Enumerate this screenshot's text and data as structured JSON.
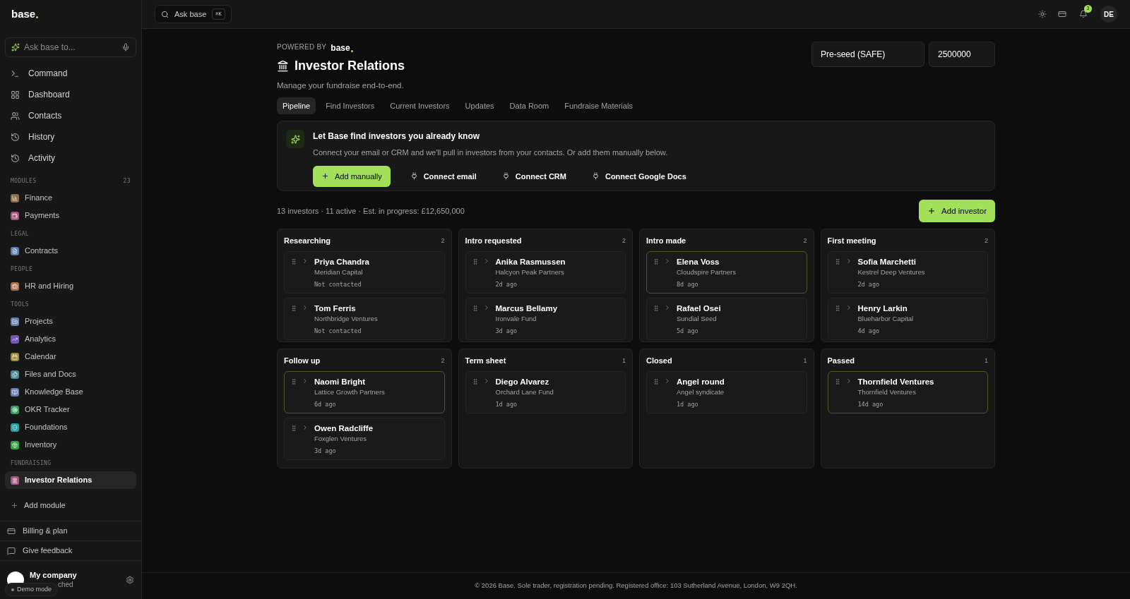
{
  "sidebar": {
    "logo": "base",
    "ask_placeholder": "Ask base to...",
    "nav": [
      {
        "label": "Command"
      },
      {
        "label": "Dashboard"
      },
      {
        "label": "Contacts"
      },
      {
        "label": "History"
      },
      {
        "label": "Activity"
      }
    ],
    "sections": [
      {
        "title": "MODULES",
        "count": "23",
        "items": [
          {
            "label": "Finance",
            "color": "#8a6e4c",
            "selected": false
          },
          {
            "label": "Payments",
            "color": "#a2567c",
            "selected": false
          }
        ]
      },
      {
        "title": "LEGAL",
        "items": [
          {
            "label": "Contracts",
            "color": "#5b7cab",
            "selected": false
          }
        ]
      },
      {
        "title": "PEOPLE",
        "items": [
          {
            "label": "HR and Hiring",
            "color": "#ad6d48",
            "selected": false
          }
        ]
      },
      {
        "title": "TOOLS",
        "items": [
          {
            "label": "Projects",
            "color": "#6a7db0",
            "selected": false
          },
          {
            "label": "Analytics",
            "color": "#7457b5",
            "selected": false
          },
          {
            "label": "Calendar",
            "color": "#9c8a3f",
            "selected": false
          },
          {
            "label": "Files and Docs",
            "color": "#4a8797",
            "selected": false
          },
          {
            "label": "Knowledge Base",
            "color": "#6880b2",
            "selected": false
          },
          {
            "label": "OKR Tracker",
            "color": "#3a9a62",
            "selected": false
          },
          {
            "label": "Foundations",
            "color": "#2a9fa3",
            "selected": false
          },
          {
            "label": "Inventory",
            "color": "#33a644",
            "selected": false
          }
        ]
      },
      {
        "title": "FUNDRAISING",
        "items": [
          {
            "label": "Investor Relations",
            "color": "#a0587c",
            "selected": true
          }
        ]
      }
    ],
    "add_module": "Add module",
    "footer_links": [
      {
        "label": "Billing & plan"
      },
      {
        "label": "Give feedback"
      }
    ],
    "company": {
      "name": "My company",
      "subtitle": "ched",
      "badge": "Demo mode"
    }
  },
  "topbar": {
    "search": "Ask base",
    "shortcut": "⌘K",
    "notifications": "3",
    "avatar": "DE"
  },
  "header": {
    "powered_by": "POWERED BY",
    "brand": "base",
    "title": "Investor Relations",
    "subtitle": "Manage your fundraise end-to-end.",
    "round": "Pre-seed (SAFE)",
    "amount": "2500000"
  },
  "tabs": [
    {
      "label": "Pipeline",
      "selected": true
    },
    {
      "label": "Find Investors",
      "selected": false
    },
    {
      "label": "Current Investors",
      "selected": false
    },
    {
      "label": "Updates",
      "selected": false
    },
    {
      "label": "Data Room",
      "selected": false
    },
    {
      "label": "Fundraise Materials",
      "selected": false
    }
  ],
  "banner": {
    "title": "Let Base find investors you already know",
    "text": "Connect your email or CRM and we'll pull in investors from your contacts. Or add them manually below.",
    "primary": "Add manually",
    "links": [
      "Connect email",
      "Connect CRM",
      "Connect Google Docs"
    ]
  },
  "summary": "13 investors · 11 active · Est. in progress: £12,650,000",
  "add_investor": "Add investor",
  "columns": [
    {
      "title": "Researching",
      "count": "2",
      "cards": [
        {
          "name": "Priya Chandra",
          "firm": "Meridian Capital",
          "status": "Not contacted",
          "highlighted": false
        },
        {
          "name": "Tom Ferris",
          "firm": "Northbridge Ventures",
          "status": "Not contacted",
          "highlighted": false
        }
      ]
    },
    {
      "title": "Intro requested",
      "count": "2",
      "cards": [
        {
          "name": "Anika Rasmussen",
          "firm": "Halcyon Peak Partners",
          "status": "2d ago",
          "highlighted": false
        },
        {
          "name": "Marcus Bellamy",
          "firm": "Ironvale Fund",
          "status": "3d ago",
          "highlighted": false
        }
      ]
    },
    {
      "title": "Intro made",
      "count": "2",
      "cards": [
        {
          "name": "Elena Voss",
          "firm": "Cloudspire Partners",
          "status": "8d ago",
          "highlighted": true
        },
        {
          "name": "Rafael Osei",
          "firm": "Sundial Seed",
          "status": "5d ago",
          "highlighted": false
        }
      ]
    },
    {
      "title": "First meeting",
      "count": "2",
      "cards": [
        {
          "name": "Sofia Marchetti",
          "firm": "Kestrel Deep Ventures",
          "status": "2d ago",
          "highlighted": false
        },
        {
          "name": "Henry Larkin",
          "firm": "Blueharbor Capital",
          "status": "4d ago",
          "highlighted": false
        }
      ]
    },
    {
      "title": "Follow up",
      "count": "2",
      "cards": [
        {
          "name": "Naomi Bright",
          "firm": "Lattice Growth Partners",
          "status": "6d ago",
          "highlighted": true
        },
        {
          "name": "Owen Radcliffe",
          "firm": "Foxglen Ventures",
          "status": "3d ago",
          "highlighted": false
        }
      ]
    },
    {
      "title": "Term sheet",
      "count": "1",
      "cards": [
        {
          "name": "Diego Alvarez",
          "firm": "Orchard Lane Fund",
          "status": "1d ago",
          "highlighted": false
        }
      ]
    },
    {
      "title": "Closed",
      "count": "1",
      "cards": [
        {
          "name": "Angel round",
          "firm": "Angel syndicate",
          "status": "1d ago",
          "highlighted": false
        }
      ]
    },
    {
      "title": "Passed",
      "count": "1",
      "cards": [
        {
          "name": "Thornfield Ventures",
          "firm": "Thornfield Ventures",
          "status": "14d ago",
          "highlighted": true
        }
      ]
    }
  ],
  "footer": "© 2026 Base. Sole trader, registration pending. Registered office: 103 Sutherland Avenue, London, W9 2QH."
}
